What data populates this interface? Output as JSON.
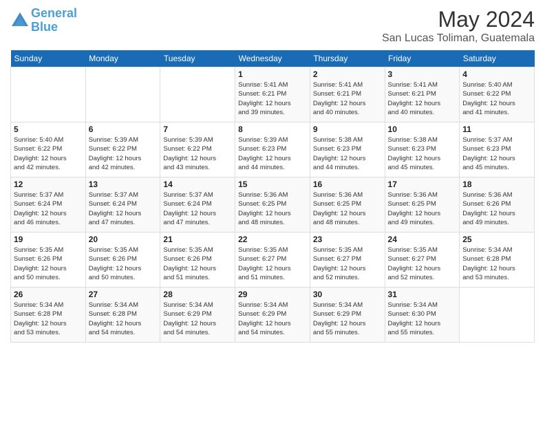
{
  "logo": {
    "line1": "General",
    "line2": "Blue"
  },
  "title": "May 2024",
  "subtitle": "San Lucas Toliman, Guatemala",
  "header": {
    "days": [
      "Sunday",
      "Monday",
      "Tuesday",
      "Wednesday",
      "Thursday",
      "Friday",
      "Saturday"
    ]
  },
  "weeks": [
    {
      "cells": [
        {
          "day": "",
          "details": ""
        },
        {
          "day": "",
          "details": ""
        },
        {
          "day": "",
          "details": ""
        },
        {
          "day": "1",
          "details": "Sunrise: 5:41 AM\nSunset: 6:21 PM\nDaylight: 12 hours\nand 39 minutes."
        },
        {
          "day": "2",
          "details": "Sunrise: 5:41 AM\nSunset: 6:21 PM\nDaylight: 12 hours\nand 40 minutes."
        },
        {
          "day": "3",
          "details": "Sunrise: 5:41 AM\nSunset: 6:21 PM\nDaylight: 12 hours\nand 40 minutes."
        },
        {
          "day": "4",
          "details": "Sunrise: 5:40 AM\nSunset: 6:22 PM\nDaylight: 12 hours\nand 41 minutes."
        }
      ]
    },
    {
      "cells": [
        {
          "day": "5",
          "details": "Sunrise: 5:40 AM\nSunset: 6:22 PM\nDaylight: 12 hours\nand 42 minutes."
        },
        {
          "day": "6",
          "details": "Sunrise: 5:39 AM\nSunset: 6:22 PM\nDaylight: 12 hours\nand 42 minutes."
        },
        {
          "day": "7",
          "details": "Sunrise: 5:39 AM\nSunset: 6:22 PM\nDaylight: 12 hours\nand 43 minutes."
        },
        {
          "day": "8",
          "details": "Sunrise: 5:39 AM\nSunset: 6:23 PM\nDaylight: 12 hours\nand 44 minutes."
        },
        {
          "day": "9",
          "details": "Sunrise: 5:38 AM\nSunset: 6:23 PM\nDaylight: 12 hours\nand 44 minutes."
        },
        {
          "day": "10",
          "details": "Sunrise: 5:38 AM\nSunset: 6:23 PM\nDaylight: 12 hours\nand 45 minutes."
        },
        {
          "day": "11",
          "details": "Sunrise: 5:37 AM\nSunset: 6:23 PM\nDaylight: 12 hours\nand 45 minutes."
        }
      ]
    },
    {
      "cells": [
        {
          "day": "12",
          "details": "Sunrise: 5:37 AM\nSunset: 6:24 PM\nDaylight: 12 hours\nand 46 minutes."
        },
        {
          "day": "13",
          "details": "Sunrise: 5:37 AM\nSunset: 6:24 PM\nDaylight: 12 hours\nand 47 minutes."
        },
        {
          "day": "14",
          "details": "Sunrise: 5:37 AM\nSunset: 6:24 PM\nDaylight: 12 hours\nand 47 minutes."
        },
        {
          "day": "15",
          "details": "Sunrise: 5:36 AM\nSunset: 6:25 PM\nDaylight: 12 hours\nand 48 minutes."
        },
        {
          "day": "16",
          "details": "Sunrise: 5:36 AM\nSunset: 6:25 PM\nDaylight: 12 hours\nand 48 minutes."
        },
        {
          "day": "17",
          "details": "Sunrise: 5:36 AM\nSunset: 6:25 PM\nDaylight: 12 hours\nand 49 minutes."
        },
        {
          "day": "18",
          "details": "Sunrise: 5:36 AM\nSunset: 6:26 PM\nDaylight: 12 hours\nand 49 minutes."
        }
      ]
    },
    {
      "cells": [
        {
          "day": "19",
          "details": "Sunrise: 5:35 AM\nSunset: 6:26 PM\nDaylight: 12 hours\nand 50 minutes."
        },
        {
          "day": "20",
          "details": "Sunrise: 5:35 AM\nSunset: 6:26 PM\nDaylight: 12 hours\nand 50 minutes."
        },
        {
          "day": "21",
          "details": "Sunrise: 5:35 AM\nSunset: 6:26 PM\nDaylight: 12 hours\nand 51 minutes."
        },
        {
          "day": "22",
          "details": "Sunrise: 5:35 AM\nSunset: 6:27 PM\nDaylight: 12 hours\nand 51 minutes."
        },
        {
          "day": "23",
          "details": "Sunrise: 5:35 AM\nSunset: 6:27 PM\nDaylight: 12 hours\nand 52 minutes."
        },
        {
          "day": "24",
          "details": "Sunrise: 5:35 AM\nSunset: 6:27 PM\nDaylight: 12 hours\nand 52 minutes."
        },
        {
          "day": "25",
          "details": "Sunrise: 5:34 AM\nSunset: 6:28 PM\nDaylight: 12 hours\nand 53 minutes."
        }
      ]
    },
    {
      "cells": [
        {
          "day": "26",
          "details": "Sunrise: 5:34 AM\nSunset: 6:28 PM\nDaylight: 12 hours\nand 53 minutes."
        },
        {
          "day": "27",
          "details": "Sunrise: 5:34 AM\nSunset: 6:28 PM\nDaylight: 12 hours\nand 54 minutes."
        },
        {
          "day": "28",
          "details": "Sunrise: 5:34 AM\nSunset: 6:29 PM\nDaylight: 12 hours\nand 54 minutes."
        },
        {
          "day": "29",
          "details": "Sunrise: 5:34 AM\nSunset: 6:29 PM\nDaylight: 12 hours\nand 54 minutes."
        },
        {
          "day": "30",
          "details": "Sunrise: 5:34 AM\nSunset: 6:29 PM\nDaylight: 12 hours\nand 55 minutes."
        },
        {
          "day": "31",
          "details": "Sunrise: 5:34 AM\nSunset: 6:30 PM\nDaylight: 12 hours\nand 55 minutes."
        },
        {
          "day": "",
          "details": ""
        }
      ]
    }
  ]
}
